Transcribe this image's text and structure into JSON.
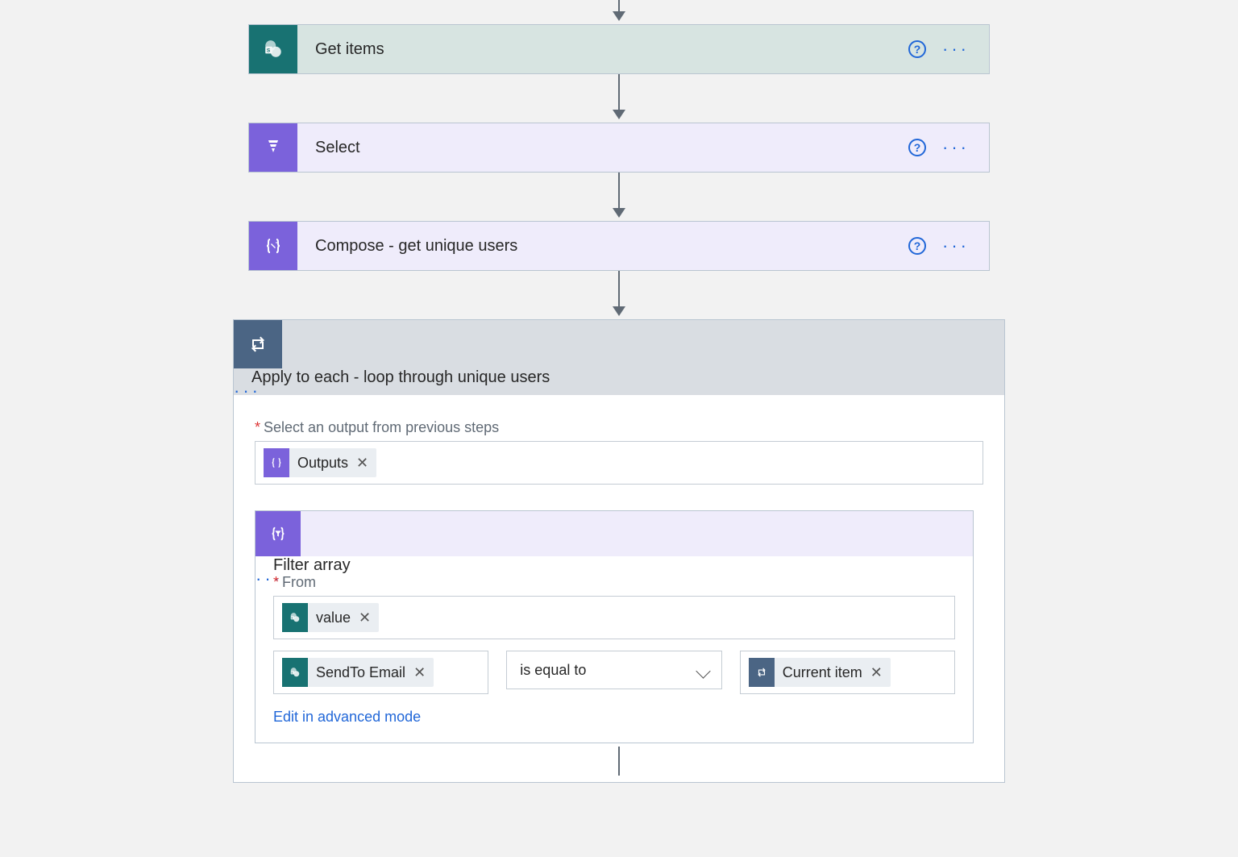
{
  "steps": {
    "get_items": {
      "title": "Get items"
    },
    "select": {
      "title": "Select"
    },
    "compose": {
      "title": "Compose - get unique users"
    },
    "apply_each": {
      "title": "Apply to each - loop through unique users",
      "field_label": "Select an output from previous steps",
      "token": "Outputs"
    },
    "filter_array": {
      "title": "Filter array",
      "from_label": "From",
      "from_token": "value",
      "left_token": "SendTo Email",
      "operator": "is equal to",
      "right_token": "Current item",
      "advanced_link": "Edit in advanced mode"
    }
  }
}
